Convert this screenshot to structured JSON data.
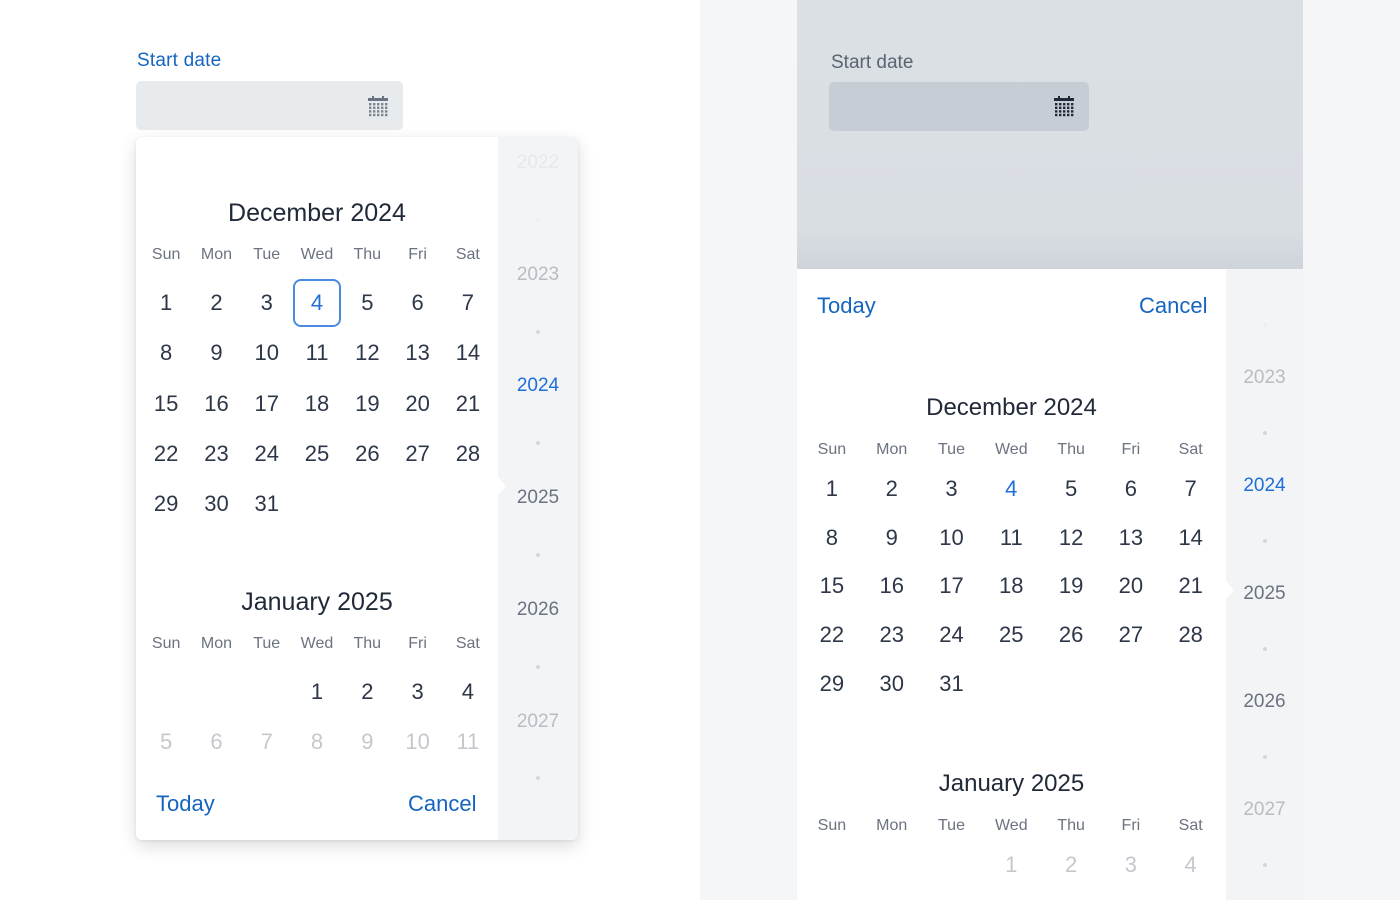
{
  "field": {
    "label": "Start date",
    "value": "",
    "icon": "calendar-icon"
  },
  "weekdays": [
    "Sun",
    "Mon",
    "Tue",
    "Wed",
    "Thu",
    "Fri",
    "Sat"
  ],
  "colors": {
    "accent": "#1565c0",
    "today": "#1e6fd9",
    "selected_border": "#4a8be0",
    "text": "#2d3748",
    "muted": "#6b7280",
    "faded": "#c4c8cd",
    "rail_bg": "#f2f4f6",
    "overlay": "#d9dee3"
  },
  "left_picker": {
    "months": [
      {
        "title": "December 2024",
        "lead_blanks": 0,
        "days": [
          {
            "d": "1"
          },
          {
            "d": "2"
          },
          {
            "d": "3"
          },
          {
            "d": "4",
            "state": "selected"
          },
          {
            "d": "5"
          },
          {
            "d": "6"
          },
          {
            "d": "7"
          },
          {
            "d": "8"
          },
          {
            "d": "9"
          },
          {
            "d": "10"
          },
          {
            "d": "11"
          },
          {
            "d": "12"
          },
          {
            "d": "13"
          },
          {
            "d": "14"
          },
          {
            "d": "15"
          },
          {
            "d": "16"
          },
          {
            "d": "17"
          },
          {
            "d": "18"
          },
          {
            "d": "19"
          },
          {
            "d": "20"
          },
          {
            "d": "21"
          },
          {
            "d": "22"
          },
          {
            "d": "23"
          },
          {
            "d": "24"
          },
          {
            "d": "25"
          },
          {
            "d": "26"
          },
          {
            "d": "27"
          },
          {
            "d": "28"
          },
          {
            "d": "29"
          },
          {
            "d": "30"
          },
          {
            "d": "31"
          }
        ]
      },
      {
        "title": "January 2025",
        "lead_blanks": 3,
        "days": [
          {
            "d": "1"
          },
          {
            "d": "2"
          },
          {
            "d": "3"
          },
          {
            "d": "4"
          },
          {
            "d": "5",
            "state": "faded"
          },
          {
            "d": "6",
            "state": "faded"
          },
          {
            "d": "7",
            "state": "faded"
          },
          {
            "d": "8",
            "state": "faded"
          },
          {
            "d": "9",
            "state": "faded"
          },
          {
            "d": "10",
            "state": "faded"
          },
          {
            "d": "11",
            "state": "faded"
          }
        ]
      }
    ],
    "years": [
      {
        "label": "2022",
        "state": "vdim"
      },
      {
        "label": "2023",
        "state": "dim"
      },
      {
        "label": "2024",
        "state": "active"
      },
      {
        "label": "2025",
        "state": "normal"
      },
      {
        "label": "2026",
        "state": "normal"
      },
      {
        "label": "2027",
        "state": "dim"
      }
    ],
    "today_label": "Today",
    "cancel_label": "Cancel"
  },
  "right_picker": {
    "today_label": "Today",
    "cancel_label": "Cancel",
    "months": [
      {
        "title": "December 2024",
        "lead_blanks": 0,
        "days": [
          {
            "d": "1"
          },
          {
            "d": "2"
          },
          {
            "d": "3"
          },
          {
            "d": "4",
            "state": "today"
          },
          {
            "d": "5"
          },
          {
            "d": "6"
          },
          {
            "d": "7"
          },
          {
            "d": "8"
          },
          {
            "d": "9"
          },
          {
            "d": "10"
          },
          {
            "d": "11"
          },
          {
            "d": "12"
          },
          {
            "d": "13"
          },
          {
            "d": "14"
          },
          {
            "d": "15"
          },
          {
            "d": "16"
          },
          {
            "d": "17"
          },
          {
            "d": "18"
          },
          {
            "d": "19"
          },
          {
            "d": "20"
          },
          {
            "d": "21"
          },
          {
            "d": "22"
          },
          {
            "d": "23"
          },
          {
            "d": "24"
          },
          {
            "d": "25"
          },
          {
            "d": "26"
          },
          {
            "d": "27"
          },
          {
            "d": "28"
          },
          {
            "d": "29"
          },
          {
            "d": "30"
          },
          {
            "d": "31"
          }
        ]
      },
      {
        "title": "January 2025",
        "lead_blanks": 3,
        "days": [
          {
            "d": "1",
            "state": "faded"
          },
          {
            "d": "2",
            "state": "faded"
          },
          {
            "d": "3",
            "state": "faded"
          },
          {
            "d": "4",
            "state": "faded"
          }
        ]
      }
    ],
    "years": [
      {
        "label": "2023",
        "state": "dim"
      },
      {
        "label": "2024",
        "state": "active"
      },
      {
        "label": "2025",
        "state": "normal"
      },
      {
        "label": "2026",
        "state": "normal"
      },
      {
        "label": "2027",
        "state": "dim"
      }
    ]
  }
}
